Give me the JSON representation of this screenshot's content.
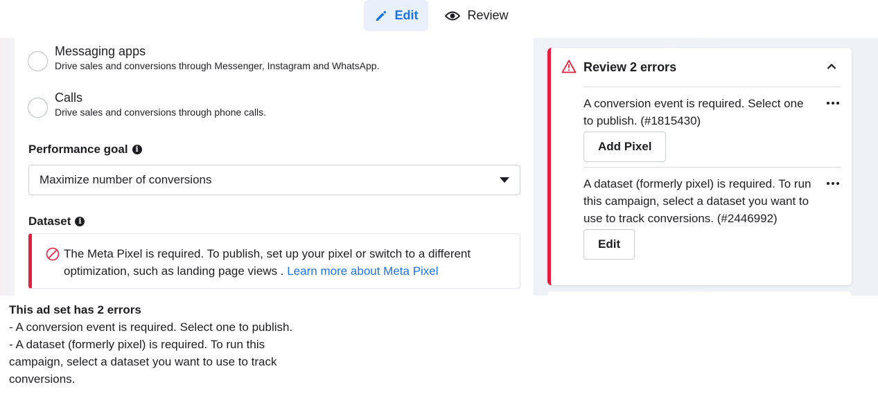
{
  "toolbar": {
    "edit_label": "Edit",
    "review_label": "Review"
  },
  "conversion_location": {
    "options": [
      {
        "title": "Messaging apps",
        "description": "Drive sales and conversions through Messenger, Instagram and WhatsApp."
      },
      {
        "title": "Calls",
        "description": "Drive sales and conversions through phone calls."
      }
    ]
  },
  "performance_goal": {
    "label": "Performance goal",
    "selected": "Maximize number of conversions"
  },
  "dataset": {
    "label": "Dataset",
    "alert_text": "The Meta Pixel is required. To publish, set up your pixel or switch to a different optimization, such as landing page views .",
    "alert_link": "Learn more about Meta Pixel"
  },
  "review_panel": {
    "title": "Review 2 errors",
    "errors": [
      {
        "text": "A conversion event is required. Select one to publish. (#1815430)",
        "button": "Add Pixel"
      },
      {
        "text": "A dataset (formerly pixel) is required. To run this campaign, select a dataset you want to use to track conversions. (#2446992)",
        "button": "Edit"
      }
    ]
  },
  "tooltip": {
    "title": "This ad set has 2 errors",
    "lines": [
      "- A conversion event is required. Select one to publish.",
      "- A dataset (formerly pixel) is required. To run this campaign, select a dataset you want to use to track conversions."
    ]
  },
  "colors": {
    "accent": "#1b74e4",
    "error": "#e41e3f",
    "edit_bg": "#e7f0fb"
  }
}
